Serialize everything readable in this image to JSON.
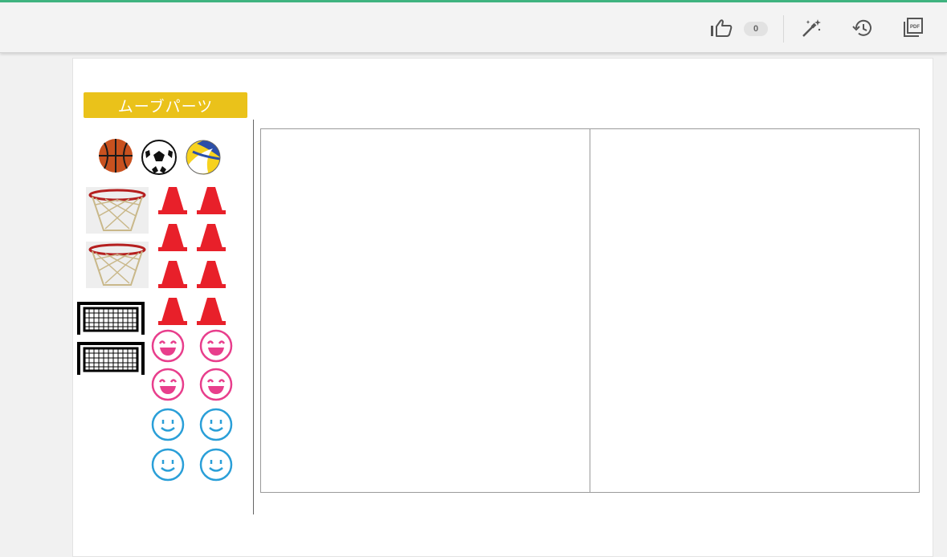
{
  "toolbar": {
    "like_count": "0",
    "icons": [
      "thumbs-up-icon",
      "magic-wand-icon",
      "history-icon",
      "pdf-export-icon"
    ],
    "pdf_icon_text": "PDF"
  },
  "parts_panel": {
    "title": "ムーブパーツ",
    "items": [
      "basketball",
      "soccer-ball",
      "volleyball",
      "basketball-hoop",
      "basketball-hoop",
      "soccer-goal",
      "soccer-goal",
      "cone",
      "cone",
      "cone",
      "cone",
      "cone",
      "cone",
      "cone",
      "cone",
      "pink-smiley",
      "pink-smiley",
      "pink-smiley",
      "pink-smiley",
      "blue-smiley",
      "blue-smiley",
      "blue-smiley",
      "blue-smiley"
    ]
  },
  "colors": {
    "accent_line": "#3fb37f",
    "label_bg": "#eac21a",
    "cone": "#e8202a",
    "pink_face": "#e83e8c",
    "blue_face": "#2a9fd8"
  }
}
